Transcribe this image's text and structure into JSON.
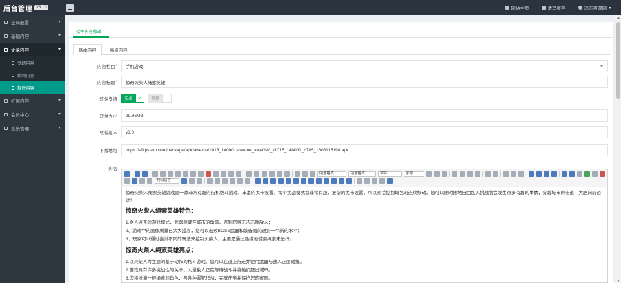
{
  "header": {
    "brand": "后台管理",
    "version": "V3.13",
    "links": [
      {
        "icon": "home-icon",
        "label": "网站主页"
      },
      {
        "icon": "trash-icon",
        "label": "清理缓存"
      },
      {
        "icon": "user-icon",
        "label": "远方资源网"
      }
    ]
  },
  "sidebar": {
    "items": [
      {
        "label": "全局配置",
        "icon": "gear-icon"
      },
      {
        "label": "基础内容",
        "icon": "layers-icon"
      },
      {
        "label": "文章内容",
        "icon": "file-icon"
      },
      {
        "label": "扩展内容",
        "icon": "puzzle-icon"
      },
      {
        "label": "会员中心",
        "icon": "user-icon"
      },
      {
        "label": "系统管理",
        "icon": "settings-icon"
      }
    ],
    "sub_items": [
      {
        "label": "专题内容"
      },
      {
        "label": "新闻内容"
      },
      {
        "label": "软件内容"
      }
    ]
  },
  "page": {
    "tab": "软件内容修改",
    "subtabs": [
      "基本内容",
      "高级内容"
    ]
  },
  "form": {
    "column_label": "内容栏目",
    "column_value": "手机游戏",
    "title_label": "内容标题",
    "title_value": "惊奇火柴人绳索英雄",
    "support_label": "软件支持",
    "support_on": "安卓",
    "support_off": "苹果",
    "size_label": "软件大小",
    "size_value": "99.86MB",
    "version_label": "软件版本",
    "version_value": "v3.0",
    "download_label": "下载地址",
    "download_value": "https://s9.pstatp.com/package/apk/aweme/1015_140001/aweme_aweGW_v1015_140001_b795_1608115190.apk",
    "content_label": "内容",
    "required_mark": "*"
  },
  "editor": {
    "toolbar_selects": [
      "代码语言",
      "段落格式",
      "段落格式",
      "字体",
      "字号"
    ],
    "intro": "惊奇火柴人绳索英雄游戏是一款非常有趣的街机格斗游戏，丰富的关卡设置，每个挑战模式都非常有趣，复杂的关卡设置，可以灵活控制角色的连续移动，您可以随时随地自由加入挑战将会发生很多有趣的事情，穿越城市的街道，大胆向前迈进！",
    "h1": "惊奇火柴人绳索英雄特色：",
    "features": [
      "1.令人兴奋的游戏模式，武器隐藏在城市的角落，否则您将无法击败敌人；",
      "2、游戏中的图像质量已大大提高，您可以击败BOSS武器和装备而前进到一个新的水平；",
      "3、玩家可以通过尝试不同的玩法来控制火柴人，主要是通过熟练地使用绳索来进行。"
    ],
    "h2": "惊奇火柴人绳索英雄亮点：",
    "highlights": [
      "1.以火柴人为主题的基于动作的格斗游戏。您可以在道上行走并使用武器与敌人正面碰撞。",
      "2.游戏具有许多挑战性的关卡，大量敌人正在等待战斗并将他们赶出城市。",
      "3.您将扮演一根绳索的角色，与各种罪犯作战，完成任务并保护您的家园。"
    ]
  }
}
